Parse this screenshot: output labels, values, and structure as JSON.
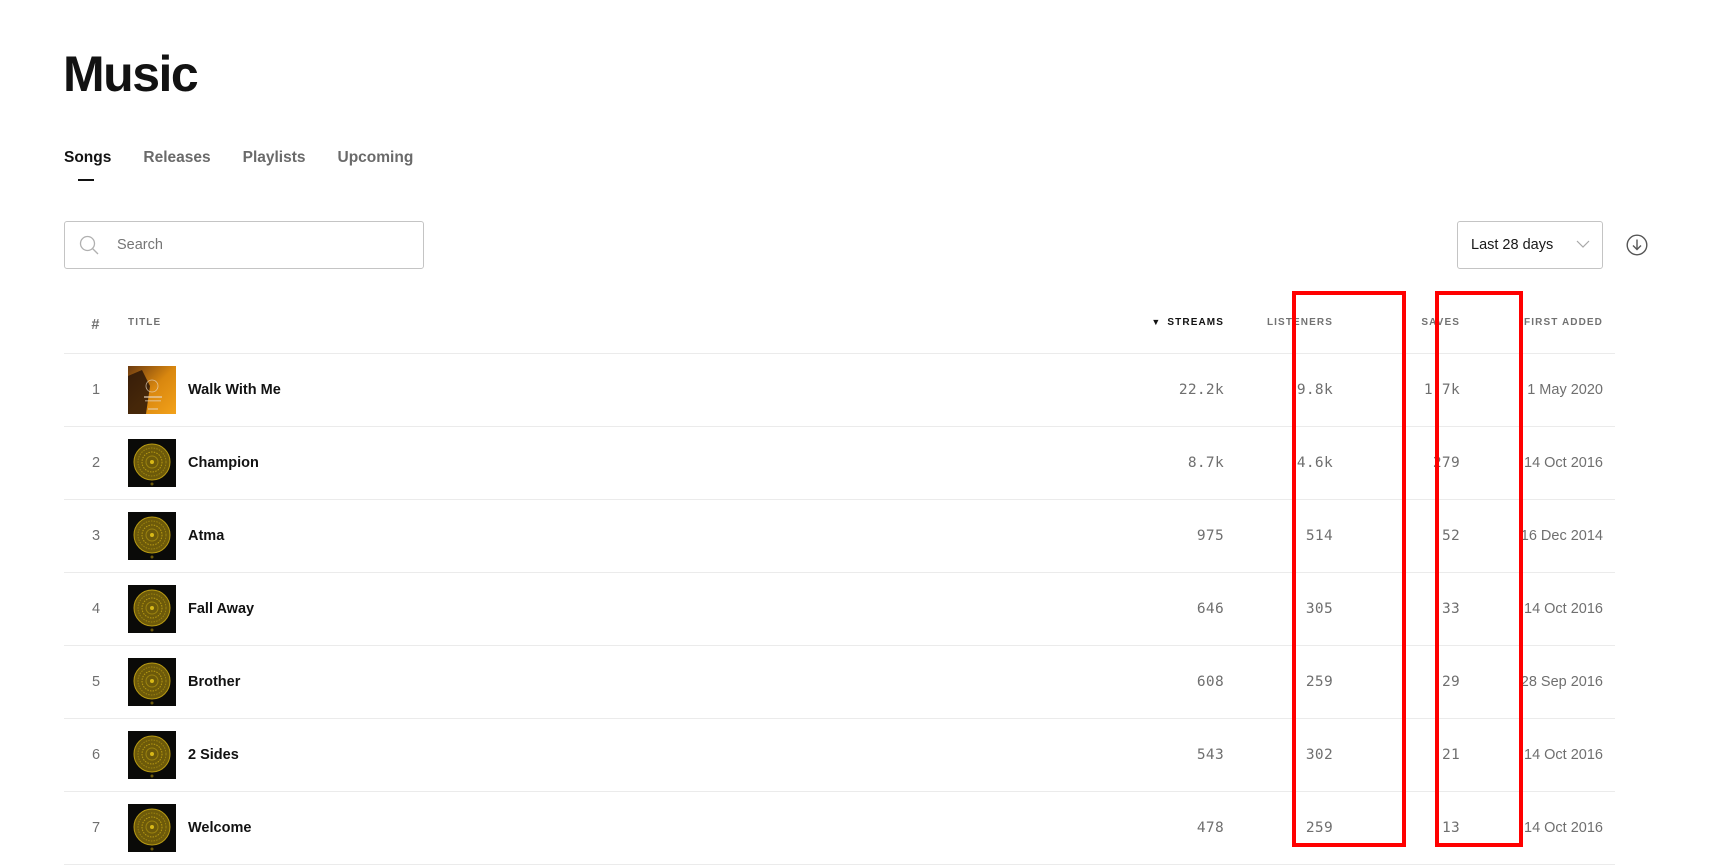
{
  "page": {
    "title": "Music"
  },
  "tabs": [
    {
      "label": "Songs",
      "active": true
    },
    {
      "label": "Releases",
      "active": false
    },
    {
      "label": "Playlists",
      "active": false
    },
    {
      "label": "Upcoming",
      "active": false
    }
  ],
  "search": {
    "placeholder": "Search",
    "value": "",
    "icon": "search-icon"
  },
  "date_range": {
    "selected": "Last 28 days",
    "icon": "chevron-down-icon"
  },
  "download": {
    "icon": "download-circle-icon"
  },
  "table": {
    "columns": {
      "num": "#",
      "title": "TITLE",
      "streams": "STREAMS",
      "listeners": "LISTENERS",
      "saves": "SAVES",
      "first_added": "FIRST ADDED"
    },
    "sort": {
      "column": "streams",
      "direction": "descending",
      "indicator": "▼"
    },
    "rows": [
      {
        "num": "1",
        "title": "Walk With Me",
        "art": "orange",
        "streams": "22.2k",
        "listeners": "9.8k",
        "saves": "1.7k",
        "first_added": "1 May 2020"
      },
      {
        "num": "2",
        "title": "Champion",
        "art": "mandala",
        "streams": "8.7k",
        "listeners": "4.6k",
        "saves": "279",
        "first_added": "14 Oct 2016"
      },
      {
        "num": "3",
        "title": "Atma",
        "art": "mandala",
        "streams": "975",
        "listeners": "514",
        "saves": "52",
        "first_added": "16 Dec 2014"
      },
      {
        "num": "4",
        "title": "Fall Away",
        "art": "mandala",
        "streams": "646",
        "listeners": "305",
        "saves": "33",
        "first_added": "14 Oct 2016"
      },
      {
        "num": "5",
        "title": "Brother",
        "art": "mandala",
        "streams": "608",
        "listeners": "259",
        "saves": "29",
        "first_added": "28 Sep 2016"
      },
      {
        "num": "6",
        "title": "2 Sides",
        "art": "mandala",
        "streams": "543",
        "listeners": "302",
        "saves": "21",
        "first_added": "14 Oct 2016"
      },
      {
        "num": "7",
        "title": "Welcome",
        "art": "mandala",
        "streams": "478",
        "listeners": "259",
        "saves": "13",
        "first_added": "14 Oct 2016"
      }
    ]
  },
  "annotations": {
    "highlight_color": "#ff0000",
    "highlighted_columns": [
      "LISTENERS",
      "SAVES"
    ]
  }
}
